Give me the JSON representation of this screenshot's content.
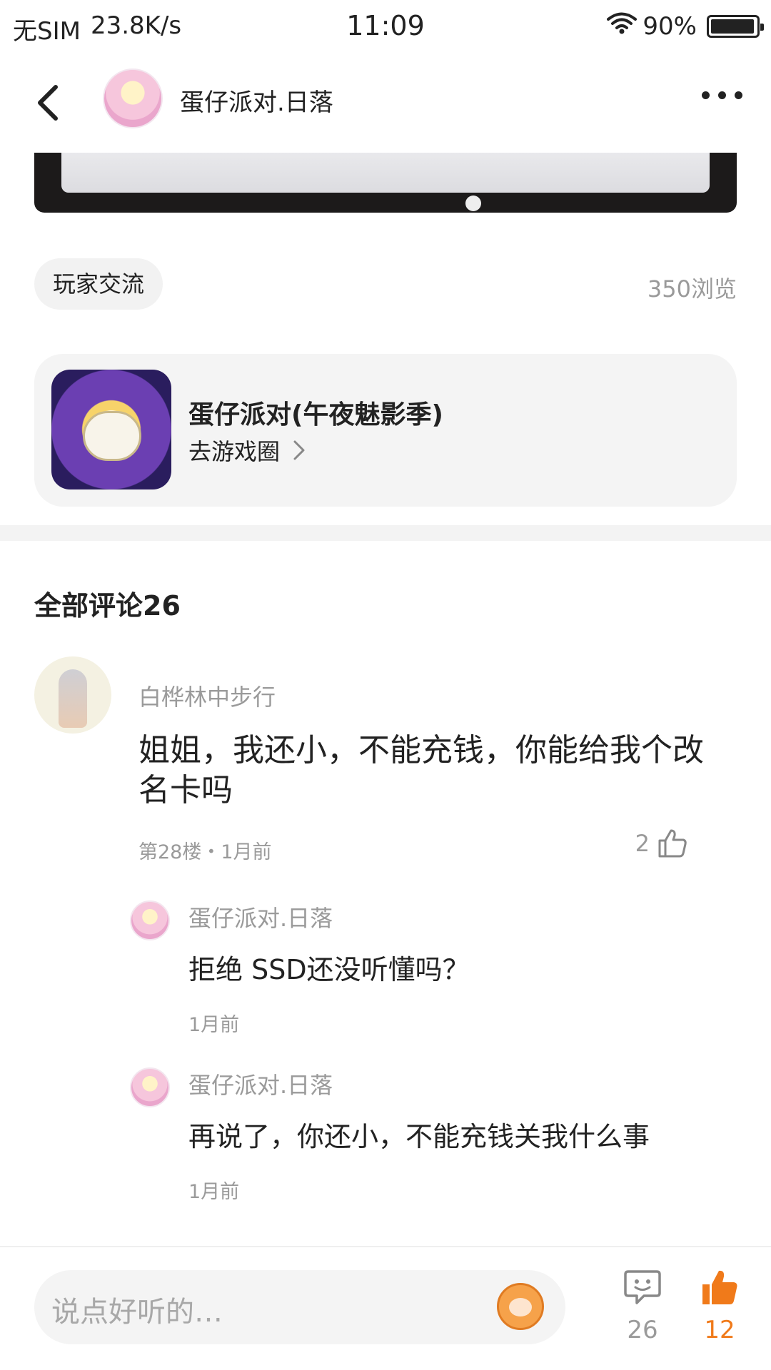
{
  "status_bar": {
    "carrier": "无SIM",
    "speed": "23.8K/s",
    "time": "11:09",
    "battery": "90%"
  },
  "nav": {
    "title": "蛋仔派对.日落"
  },
  "post": {
    "tag": "玩家交流",
    "views": "350浏览"
  },
  "game_card": {
    "title": "蛋仔派对(午夜魅影季)",
    "link_label": "去游戏圈"
  },
  "comments": {
    "header": "全部评论26",
    "items": [
      {
        "username": "白桦林中步行",
        "text": "姐姐，我还小，不能充钱，你能给我个改名卡吗",
        "meta": "第28楼・1月前",
        "likes": "2",
        "replies": [
          {
            "username": "蛋仔派对.日落",
            "text": "拒绝 SSD还没听懂吗？",
            "time": "1月前"
          },
          {
            "username": "蛋仔派对.日落",
            "text": "再说了，你还小，不能充钱关我什么事",
            "time": "1月前"
          }
        ]
      }
    ]
  },
  "bottom_bar": {
    "input_placeholder": "说点好听的…",
    "comment_count": "26",
    "like_count": "12"
  },
  "colors": {
    "accent_orange": "#f07a1a",
    "muted_text": "#9a9a9a"
  },
  "icons": [
    "back-arrow-icon",
    "more-dots-icon",
    "chevron-right-icon",
    "thumbs-up-icon",
    "comment-bubble-icon",
    "emoji-mascot-icon",
    "wifi-icon",
    "battery-icon"
  ]
}
